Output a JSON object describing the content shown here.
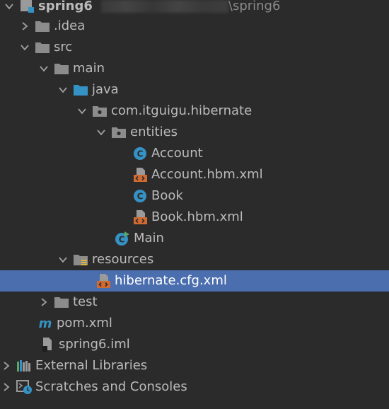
{
  "project": {
    "name": "spring6",
    "path_suffix": "\\spring6"
  },
  "nodes": {
    "idea": "idea",
    "idea_dot": ".",
    "src": "src",
    "main": "main",
    "java": "java",
    "package": "com.itguigu.hibernate",
    "entities": "entities",
    "account": "Account",
    "account_hbm": "Account.hbm.xml",
    "book": "Book",
    "book_hbm": "Book.hbm.xml",
    "main_class": "Main",
    "resources": "resources",
    "hibernate_cfg": "hibernate.cfg.xml",
    "test": "test",
    "pom": "pom.xml",
    "iml": "spring6.iml",
    "external_libraries": "External Libraries",
    "scratches": "Scratches and Consoles"
  },
  "colors": {
    "background": "#2b2b2b",
    "selection": "#4b6eaf",
    "text": "#bbbbbb",
    "folder": "#8c8c8c",
    "source_folder": "#3592c4",
    "class_icon": "#3592c4",
    "xml_icon": "#d06a31"
  }
}
